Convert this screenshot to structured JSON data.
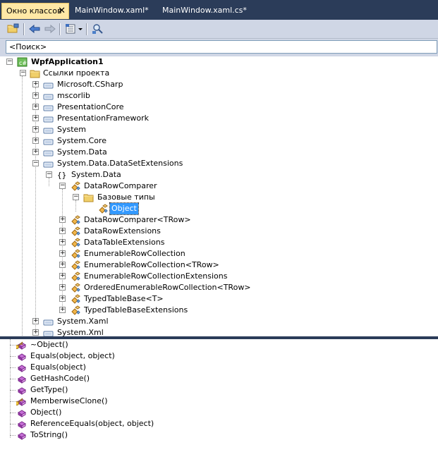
{
  "tabs": [
    {
      "label": "Окно классов",
      "close": "✕"
    },
    {
      "label": "MainWindow.xaml*"
    },
    {
      "label": "MainWindow.xaml.cs*"
    }
  ],
  "search": {
    "value": "<Поиск>"
  },
  "tree": {
    "project": "WpfApplication1",
    "refs_folder": "Ссылки проекта",
    "references": [
      "Microsoft.CSharp",
      "mscorlib",
      "PresentationCore",
      "PresentationFramework",
      "System",
      "System.Core",
      "System.Data",
      "System.Data.DataSetExtensions"
    ],
    "namespace": "System.Data",
    "class": "DataRowComparer",
    "base_folder": "Базовые типы",
    "base_item": "Object",
    "siblings": [
      "DataRowComparer<TRow>",
      "DataRowExtensions",
      "DataTableExtensions",
      "EnumerableRowCollection",
      "EnumerableRowCollection<TRow>",
      "EnumerableRowCollectionExtensions",
      "OrderedEnumerableRowCollection<TRow>",
      "TypedTableBase<T>",
      "TypedTableBaseExtensions"
    ],
    "tail_refs": [
      "System.Xaml",
      "System.Xml"
    ]
  },
  "members": [
    {
      "label": "~Object()",
      "kind": "protected"
    },
    {
      "label": "Equals(object, object)",
      "kind": "public"
    },
    {
      "label": "Equals(object)",
      "kind": "public"
    },
    {
      "label": "GetHashCode()",
      "kind": "public"
    },
    {
      "label": "GetType()",
      "kind": "public"
    },
    {
      "label": "MemberwiseClone()",
      "kind": "protected"
    },
    {
      "label": "Object()",
      "kind": "public"
    },
    {
      "label": "ReferenceEquals(object, object)",
      "kind": "public"
    },
    {
      "label": "ToString()",
      "kind": "public"
    }
  ],
  "colors": {
    "titlebar": "#2b3c59",
    "active_tab": "#ffe8a6",
    "toolbar": "#cfd6e5",
    "selection": "#3399ff",
    "method_icon": "#b63fc4"
  }
}
